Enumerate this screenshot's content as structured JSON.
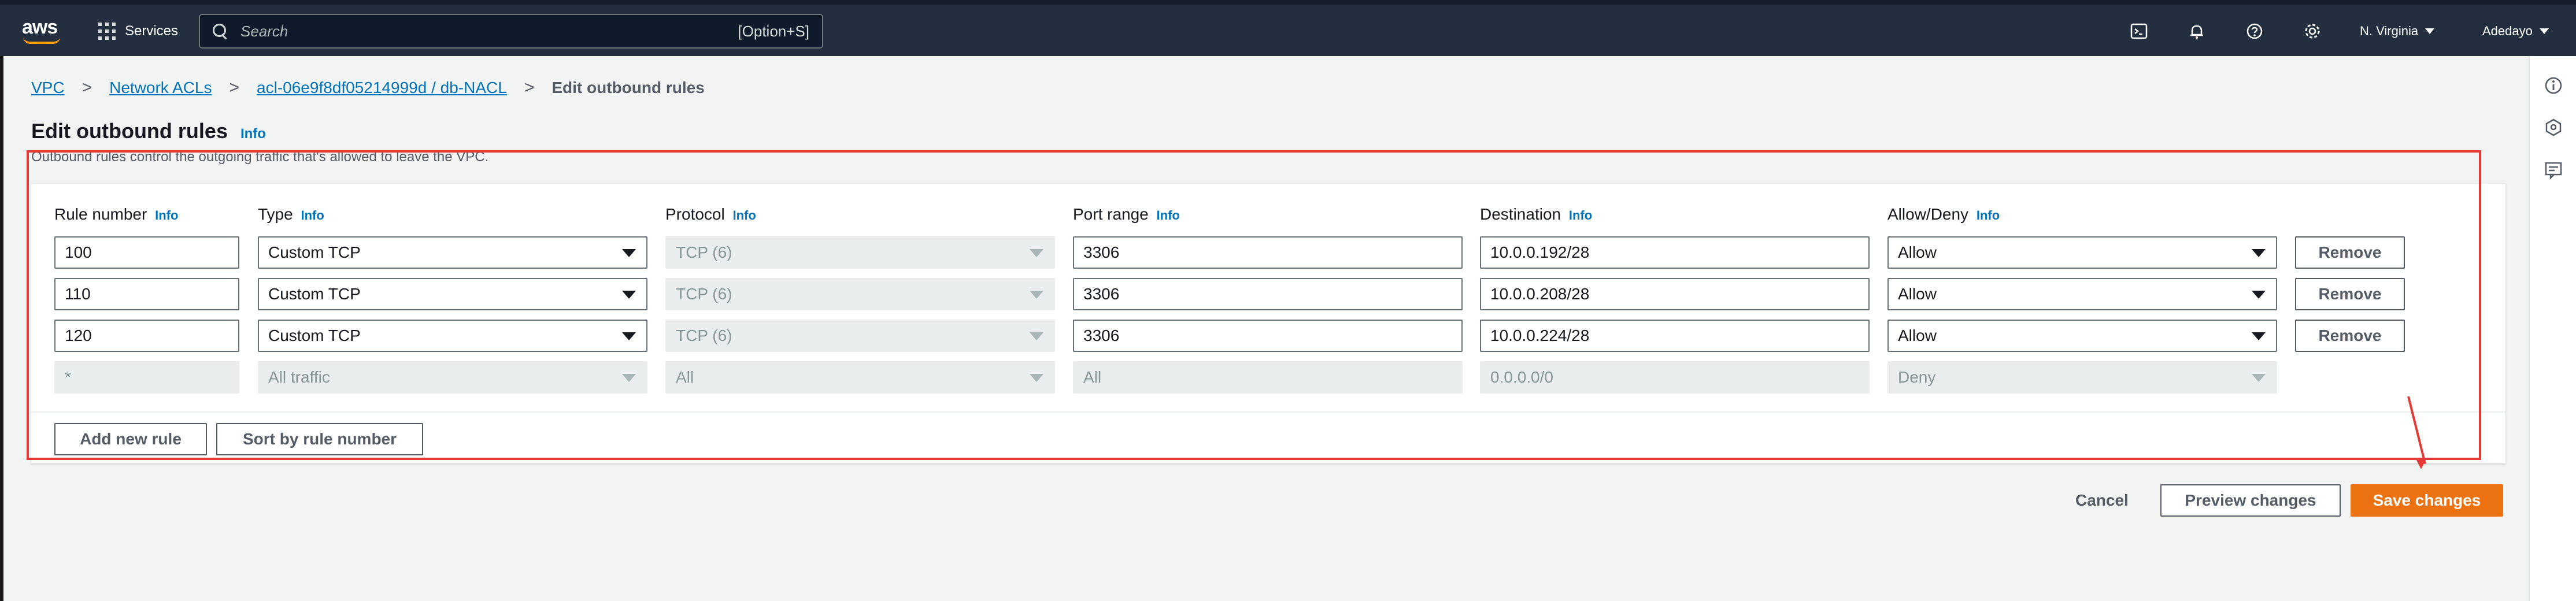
{
  "nav": {
    "logo": "aws",
    "services_label": "Services",
    "search_placeholder": "Search",
    "search_shortcut": "[Option+S]",
    "region": "N. Virginia",
    "user": "Adedayo",
    "icons": [
      "cloudshell-icon",
      "notifications-icon",
      "help-icon",
      "settings-icon"
    ]
  },
  "breadcrumb": {
    "items": [
      "VPC",
      "Network ACLs",
      "acl-06e9f8df05214999d / db-NACL"
    ],
    "current": "Edit outbound rules"
  },
  "header": {
    "title": "Edit outbound rules",
    "info": "Info",
    "description": "Outbound rules control the outgoing traffic that's allowed to leave the VPC."
  },
  "columns": {
    "rule_number": "Rule number",
    "type": "Type",
    "protocol": "Protocol",
    "port_range": "Port range",
    "destination": "Destination",
    "allow_deny": "Allow/Deny",
    "info": "Info"
  },
  "rules": [
    {
      "rule_number": "100",
      "type": "Custom TCP",
      "protocol": "TCP (6)",
      "port_range": "3306",
      "destination": "10.0.0.192/28",
      "allow_deny": "Allow",
      "remove": "Remove"
    },
    {
      "rule_number": "110",
      "type": "Custom TCP",
      "protocol": "TCP (6)",
      "port_range": "3306",
      "destination": "10.0.0.208/28",
      "allow_deny": "Allow",
      "remove": "Remove"
    },
    {
      "rule_number": "120",
      "type": "Custom TCP",
      "protocol": "TCP (6)",
      "port_range": "3306",
      "destination": "10.0.0.224/28",
      "allow_deny": "Allow",
      "remove": "Remove"
    }
  ],
  "default_rule": {
    "rule_number": "*",
    "type": "All traffic",
    "protocol": "All",
    "port_range": "All",
    "destination": "0.0.0.0/0",
    "allow_deny": "Deny"
  },
  "actions": {
    "add_new_rule": "Add new rule",
    "sort_by_rule_number": "Sort by rule number",
    "cancel": "Cancel",
    "preview_changes": "Preview changes",
    "save_changes": "Save changes"
  },
  "colors": {
    "nav_bg": "#232f3e",
    "link": "#0073bb",
    "primary": "#ec7211",
    "annotation": "#e53935"
  }
}
